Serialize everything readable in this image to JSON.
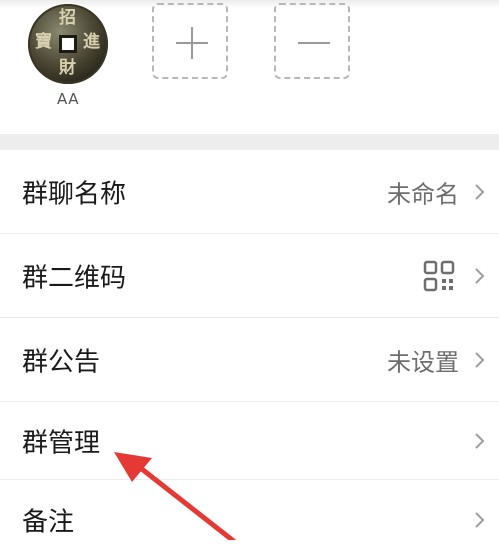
{
  "members": [
    {
      "name": "AA",
      "avatar_chars": [
        "招",
        "進",
        "財",
        "寶"
      ]
    }
  ],
  "add_member": {
    "icon": "plus-icon"
  },
  "remove_member": {
    "icon": "minus-icon"
  },
  "settings": [
    {
      "label": "群聊名称",
      "value": "未命名"
    },
    {
      "label": "群二维码",
      "value": "",
      "icon": "qr-code-icon"
    },
    {
      "label": "群公告",
      "value": "未设置"
    },
    {
      "label": "群管理",
      "value": ""
    },
    {
      "label": "备注",
      "value": ""
    }
  ],
  "annotation": {
    "color": "#e53935"
  }
}
